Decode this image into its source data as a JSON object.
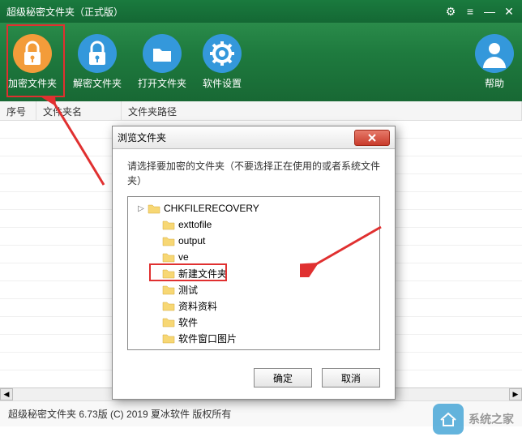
{
  "titlebar": {
    "title": "超级秘密文件夹（正式版）"
  },
  "toolbar": {
    "items": [
      {
        "label": "加密文件夹",
        "icon": "lock-icon",
        "color": "#f39c3a"
      },
      {
        "label": "解密文件夹",
        "icon": "unlock-icon",
        "color": "#3498db"
      },
      {
        "label": "打开文件夹",
        "icon": "folder-open-icon",
        "color": "#3498db"
      },
      {
        "label": "软件设置",
        "icon": "gear-icon",
        "color": "#3498db"
      }
    ],
    "help": {
      "label": "帮助",
      "icon": "user-icon",
      "color": "#3498db"
    }
  },
  "columns": {
    "c1": "序号",
    "c2": "文件夹名",
    "c3": "文件夹路径"
  },
  "dialog": {
    "title": "浏览文件夹",
    "message": "请选择要加密的文件夹（不要选择正在使用的或者系统文件夹）",
    "tree": [
      {
        "label": "CHKFILERECOVERY",
        "depth": 1,
        "expand": "▷"
      },
      {
        "label": "exttofile",
        "depth": 2,
        "expand": ""
      },
      {
        "label": "output",
        "depth": 2,
        "expand": ""
      },
      {
        "label": "ve",
        "depth": 2,
        "expand": ""
      },
      {
        "label": "新建文件夹",
        "depth": 2,
        "expand": "",
        "selected": true
      },
      {
        "label": "测试",
        "depth": 2,
        "expand": ""
      },
      {
        "label": "资料资料",
        "depth": 2,
        "expand": ""
      },
      {
        "label": "软件",
        "depth": 2,
        "expand": ""
      },
      {
        "label": "软件窗口图片",
        "depth": 2,
        "expand": ""
      }
    ],
    "ok": "确定",
    "cancel": "取消"
  },
  "statusbar": {
    "text": "超级秘密文件夹 6.73版 (C) 2019 夏冰软件 版权所有"
  },
  "watermark": {
    "text": "系统之家"
  }
}
